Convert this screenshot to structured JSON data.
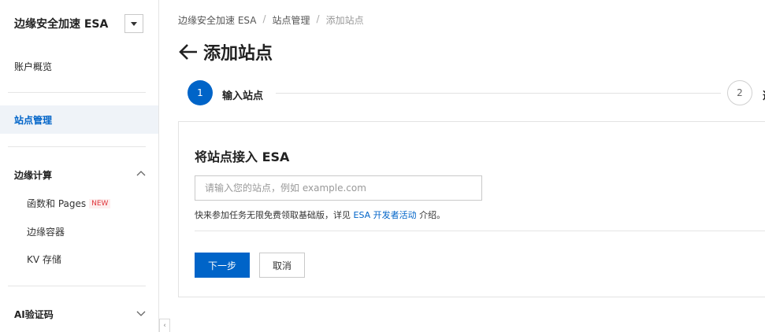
{
  "sidebar": {
    "product_title": "边缘安全加速 ESA",
    "account_overview": "账户概览",
    "site_management": "站点管理",
    "edge_compute": {
      "label": "边缘计算",
      "items": [
        {
          "label": "函数和 Pages",
          "badge": "NEW"
        },
        {
          "label": "边缘容器"
        },
        {
          "label": "KV 存储"
        }
      ]
    },
    "ai_captcha": "AI验证码"
  },
  "breadcrumb": [
    "边缘安全加速 ESA",
    "站点管理",
    "添加站点"
  ],
  "page_title": "添加站点",
  "steps": [
    {
      "number": "1",
      "label": "输入站点",
      "state": "active"
    },
    {
      "number": "2",
      "label": "选",
      "state": "todo"
    }
  ],
  "form": {
    "title": "将站点接入 ESA",
    "site_input": {
      "value": "",
      "placeholder": "请输入您的站点，例如 example.com"
    },
    "hint_prefix": "快来参加任务无限免费领取基础版，详见 ",
    "hint_link": "ESA 开发者活动",
    "hint_suffix": " 介绍。",
    "next_button": "下一步",
    "cancel_button": "取消"
  },
  "colors": {
    "accent": "#0064c8",
    "badge": "#e0383e"
  }
}
